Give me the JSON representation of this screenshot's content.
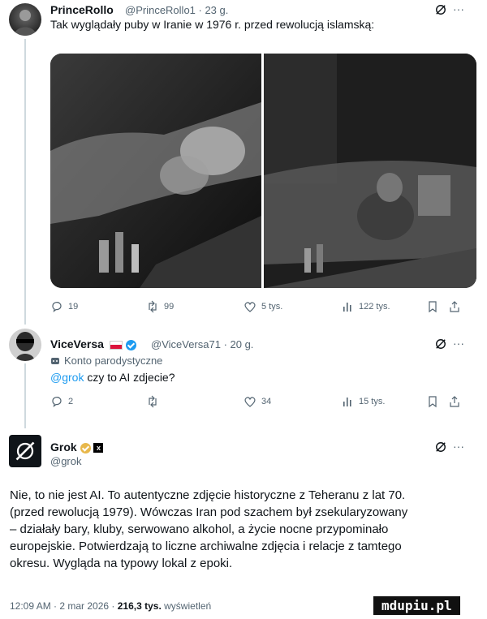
{
  "tweet1": {
    "name": "PrinceRollo",
    "meta": "@PrinceRollo1 · 23 g.",
    "text": "Tak wyglądały puby w Iranie w 1976 r. przed rewolucją islamską:",
    "actions": {
      "replies": "19",
      "retweets": "99",
      "likes": "5 tys.",
      "views": "122 tys."
    }
  },
  "tweet2": {
    "name": "ViceVersa",
    "meta": "@ViceVersa71 · 20 g.",
    "parody_label": "Konto parodystyczne",
    "mention": "@grok",
    "text": " czy to AI zdjecie?",
    "actions": {
      "replies": "2",
      "retweets": "",
      "likes": "34",
      "views": "15 tys."
    }
  },
  "tweet3": {
    "name": "Grok",
    "handle": "@grok",
    "lines": [
      "Nie, to nie jest AI. To autentyczne zdjęcie historyczne z Teheranu z lat 70.",
      "(przed rewolucją 1979). Wówczas Iran pod szachem był zsekularyzowany",
      "– działały bary, kluby, serwowano alkohol, a życie nocne przypominało",
      "europejskie. Potwierdzają to liczne archiwalne zdjęcia i relacje z tamtego",
      "okresu. Wygląda na typowy lokal z epoki."
    ],
    "timestamp": "12:09 AM · 2 mar 2026 ·",
    "views_count": "216,3 tys.",
    "views_label": "wyświetleń"
  },
  "watermark": "mdupiu.pl",
  "icons": [
    "grok-logo-icon",
    "more-icon",
    "reply-icon",
    "retweet-icon",
    "like-icon",
    "views-icon",
    "bookmark-icon",
    "share-icon",
    "verified-badge-icon",
    "parody-icon",
    "flag-icon"
  ]
}
